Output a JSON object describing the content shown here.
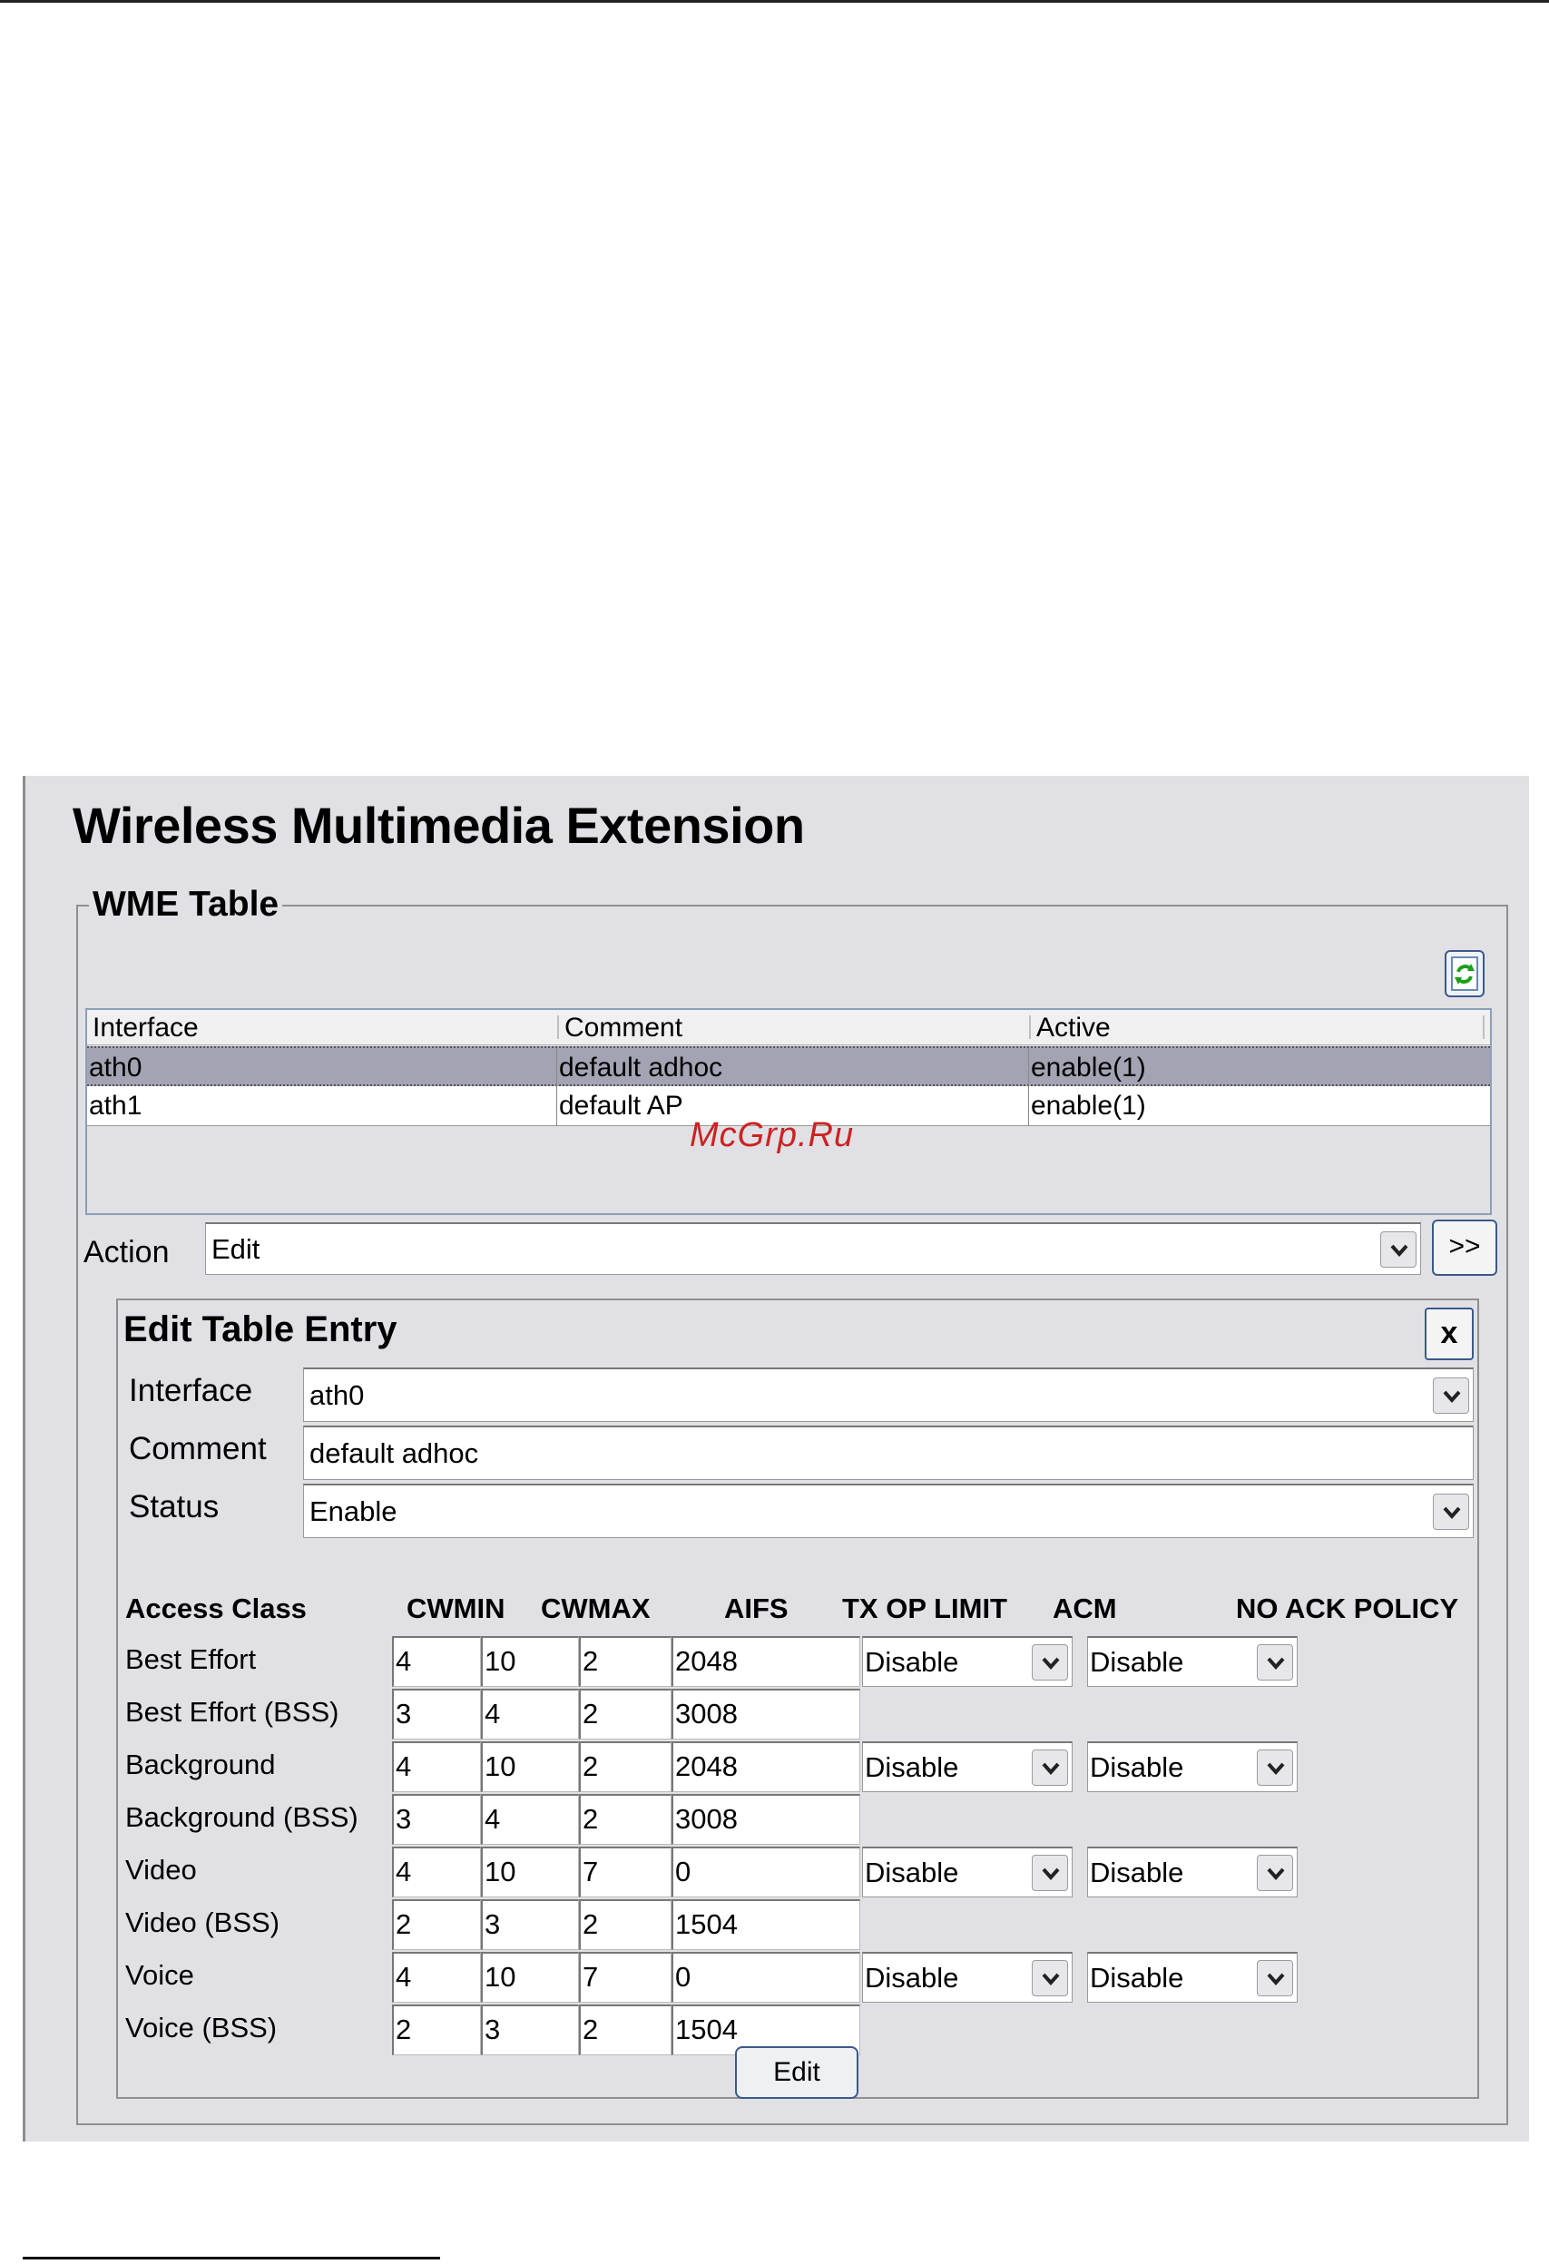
{
  "page": {
    "title": "Wireless Multimedia Extension"
  },
  "wme_table": {
    "legend": "WME Table",
    "columns": [
      "Interface",
      "Comment",
      "Active"
    ],
    "rows": [
      [
        "ath0",
        "default adhoc",
        "enable(1)"
      ],
      [
        "ath1",
        "default AP",
        "enable(1)"
      ]
    ],
    "selected_row": 0
  },
  "action": {
    "label": "Action",
    "value": "Edit",
    "go_label": ">>"
  },
  "edit_entry": {
    "title": "Edit Table Entry",
    "close_label": "x",
    "interface_label": "Interface",
    "interface_value": "ath0",
    "comment_label": "Comment",
    "comment_value": "default adhoc",
    "status_label": "Status",
    "status_value": "Enable",
    "headers": [
      "Access Class",
      "CWMIN",
      "CWMAX",
      "AIFS",
      "TX OP LIMIT",
      "ACM",
      "NO ACK POLICY"
    ],
    "rows": [
      {
        "class": "Best Effort",
        "cwmin": "4",
        "cwmax": "10",
        "aifs": "2",
        "txop": "2048",
        "acm": "Disable",
        "noack": "Disable"
      },
      {
        "class": "Best Effort (BSS)",
        "cwmin": "3",
        "cwmax": "4",
        "aifs": "2",
        "txop": "3008"
      },
      {
        "class": "Background",
        "cwmin": "4",
        "cwmax": "10",
        "aifs": "2",
        "txop": "2048",
        "acm": "Disable",
        "noack": "Disable"
      },
      {
        "class": "Background (BSS)",
        "cwmin": "3",
        "cwmax": "4",
        "aifs": "2",
        "txop": "3008"
      },
      {
        "class": "Video",
        "cwmin": "4",
        "cwmax": "10",
        "aifs": "7",
        "txop": "0",
        "acm": "Disable",
        "noack": "Disable"
      },
      {
        "class": "Video (BSS)",
        "cwmin": "2",
        "cwmax": "3",
        "aifs": "2",
        "txop": "1504"
      },
      {
        "class": "Voice",
        "cwmin": "4",
        "cwmax": "10",
        "aifs": "7",
        "txop": "0",
        "acm": "Disable",
        "noack": "Disable"
      },
      {
        "class": "Voice (BSS)",
        "cwmin": "2",
        "cwmax": "3",
        "aifs": "2",
        "txop": "1504"
      }
    ],
    "submit_label": "Edit"
  },
  "watermark": "McGrp.Ru",
  "icons": {
    "refresh": "refresh-icon",
    "dropdown": "chevron-down-icon"
  }
}
